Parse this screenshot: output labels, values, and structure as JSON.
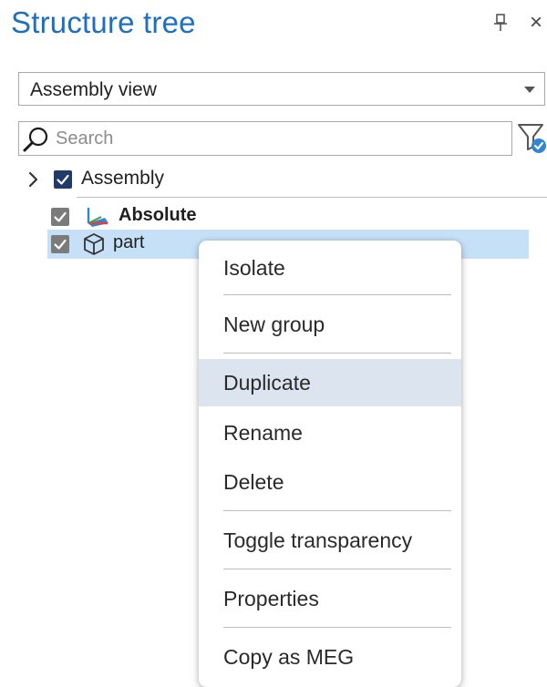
{
  "panel": {
    "title": "Structure tree",
    "pin_icon": "pin-icon",
    "close_glyph": "×",
    "close_icon": "close-icon"
  },
  "view_select": {
    "value": "Assembly view",
    "arrow_icon": "chevron-down-icon"
  },
  "search": {
    "placeholder": "Search",
    "value": "",
    "icon": "search-icon",
    "filter_icon": "filter-icon"
  },
  "tree": {
    "assembly": {
      "label": "Assembly",
      "checked": true,
      "expanded": false
    },
    "absolute": {
      "label": "Absolute",
      "checked": true,
      "icon": "coordinate-axes-icon"
    },
    "part": {
      "label": "part",
      "checked": true,
      "selected": true,
      "icon": "cube-icon"
    }
  },
  "context_menu": {
    "items": [
      {
        "label": "Isolate"
      },
      {
        "label": "New group"
      },
      {
        "label": "Duplicate",
        "highlighted": true
      },
      {
        "label": "Rename"
      },
      {
        "label": "Delete"
      },
      {
        "label": "Toggle transparency"
      },
      {
        "label": "Properties"
      },
      {
        "label": "Copy as MEG"
      }
    ]
  },
  "colors": {
    "accent": "#1e6fc2",
    "selection": "#c5e0f7",
    "menu_highlight": "#dce4f0",
    "checkbox_checked": "#1f3a6b",
    "checkbox_disabled": "#7b7b7b"
  }
}
